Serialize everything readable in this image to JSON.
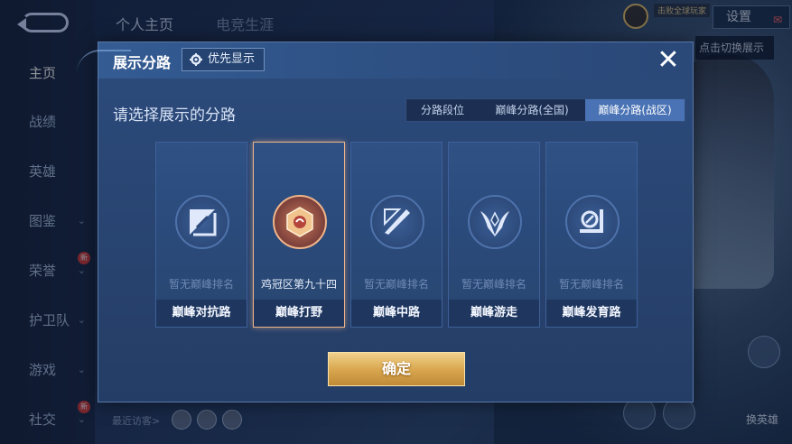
{
  "background": {
    "top_tabs": [
      "个人主页",
      "电竞生涯"
    ],
    "settings_label": "设置",
    "switch_hint": "点击切换展示",
    "top_badge": "击败全球玩家",
    "nav_items": [
      {
        "label": "主页",
        "active": true,
        "arrow": false,
        "badge": ""
      },
      {
        "label": "战绩",
        "active": false,
        "arrow": false,
        "badge": ""
      },
      {
        "label": "英雄",
        "active": false,
        "arrow": false,
        "badge": ""
      },
      {
        "label": "图鉴",
        "active": false,
        "arrow": true,
        "badge": ""
      },
      {
        "label": "荣誉",
        "active": false,
        "arrow": true,
        "badge": "新"
      },
      {
        "label": "护卫队",
        "active": false,
        "arrow": true,
        "badge": ""
      },
      {
        "label": "游戏",
        "active": false,
        "arrow": true,
        "badge": ""
      },
      {
        "label": "社交",
        "active": false,
        "arrow": true,
        "badge": "新"
      }
    ],
    "visitors_label": "最近访客>",
    "change_hero_label": "换英雄"
  },
  "modal": {
    "title": "展示分路",
    "priority_label": "优先显示",
    "close_symbol": "✕",
    "subtitle": "请选择展示的分路",
    "tabs": [
      {
        "label": "分路段位",
        "active": false
      },
      {
        "label": "巅峰分路(全国)",
        "active": false
      },
      {
        "label": "巅峰分路(战区)",
        "active": true
      }
    ],
    "lanes": [
      {
        "name": "巅峰对抗路",
        "rank": "暂无巅峰排名",
        "selected": false,
        "icon": "clash-lane-icon"
      },
      {
        "name": "巅峰打野",
        "rank": "鸡冠区第九十四",
        "selected": true,
        "icon": "jungle-rank-emblem-icon"
      },
      {
        "name": "巅峰中路",
        "rank": "暂无巅峰排名",
        "selected": false,
        "icon": "mid-lane-icon"
      },
      {
        "name": "巅峰游走",
        "rank": "暂无巅峰排名",
        "selected": false,
        "icon": "roam-lane-icon"
      },
      {
        "name": "巅峰发育路",
        "rank": "暂无巅峰排名",
        "selected": false,
        "icon": "farm-lane-icon"
      }
    ],
    "confirm_label": "确定"
  },
  "colors": {
    "accent_gold": "#d9a850",
    "active_tab": "#4a73b5",
    "selected_border": "#f0b48a"
  }
}
